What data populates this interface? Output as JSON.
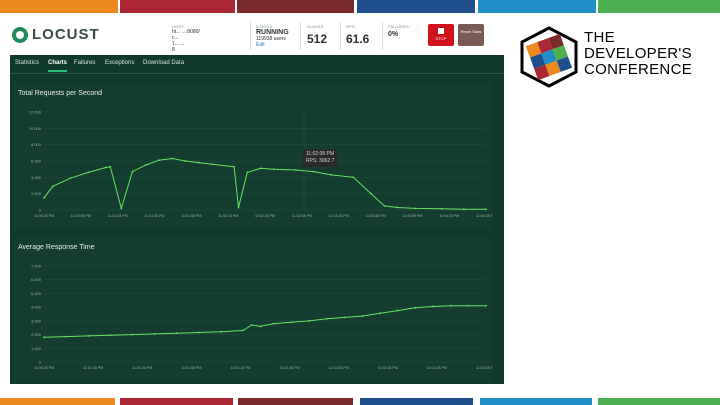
{
  "app": {
    "logo_text": "LOCUST",
    "host": {
      "label": "HOST",
      "line1": "ht... ...:8080/",
      "line2": "c... ",
      "line3": "1...  ...",
      "line4": "8"
    },
    "status": {
      "label": "STATUS",
      "value": "RUNNING",
      "sub": "119938 users",
      "link": "Edit"
    },
    "users": {
      "label": "SLAVES",
      "value": "512"
    },
    "rps": {
      "label": "RPS",
      "value": "61.6"
    },
    "failures": {
      "label": "FAILURES",
      "value": "0%"
    },
    "stop_label": "STOP",
    "reset_label": "Reset Stats",
    "tabs": [
      "Statistics",
      "Charts",
      "Failures",
      "Exceptions",
      "Download Data"
    ],
    "active_tab": "Charts"
  },
  "charts": {
    "rps_title": "Total Requests per Second",
    "rt_title": "Average Response Time",
    "tooltip": {
      "time": "11:02:08 PM",
      "value": "RPS: 3062.7"
    }
  },
  "brand": {
    "line1": "THE",
    "line2": "DEVELOPER'S",
    "line3": "CONFERENCE"
  },
  "colors": {
    "bg": "#0f3a2b",
    "line": "#63e55d",
    "stop": "#d0121c"
  },
  "chart_data": [
    {
      "type": "line",
      "title": "Total Requests per Second",
      "x": [
        "11:00:38 PM",
        "11:00:58 PM",
        "11:01:18 PM",
        "11:01:38 PM",
        "11:01:58 PM",
        "11:02:18 PM",
        "11:02:38 PM",
        "11:02:58 PM",
        "11:03:18 PM",
        "11:03:38 PM",
        "11:03:58 PM",
        "11:04:18 PM",
        "11:04:38 PM"
      ],
      "y_ticks": [
        "12,000",
        "10,000",
        "8,000",
        "6,000",
        "4,000",
        "2,000",
        "0"
      ],
      "ylim": [
        0,
        12000
      ],
      "series": [
        {
          "points": [
            [
              0,
              1500
            ],
            [
              0.02,
              2900
            ],
            [
              0.06,
              3900
            ],
            [
              0.1,
              4600
            ],
            [
              0.14,
              5200
            ],
            [
              0.15,
              5300
            ],
            [
              0.175,
              200
            ],
            [
              0.2,
              4700
            ],
            [
              0.23,
              5500
            ],
            [
              0.26,
              6100
            ],
            [
              0.29,
              6300
            ],
            [
              0.32,
              6000
            ],
            [
              0.35,
              5800
            ],
            [
              0.38,
              5600
            ],
            [
              0.43,
              5300
            ],
            [
              0.44,
              300
            ],
            [
              0.46,
              4600
            ],
            [
              0.49,
              5100
            ],
            [
              0.52,
              5000
            ],
            [
              0.57,
              4900
            ],
            [
              0.61,
              4700
            ],
            [
              0.65,
              4300
            ],
            [
              0.7,
              4000
            ],
            [
              0.74,
              2000
            ],
            [
              0.77,
              500
            ],
            [
              0.8,
              300
            ],
            [
              0.84,
              200
            ],
            [
              0.9,
              150
            ],
            [
              0.95,
              100
            ],
            [
              1.0,
              80
            ]
          ]
        }
      ]
    },
    {
      "type": "line",
      "title": "Average Response Time",
      "x": [
        "11:00:38 PM",
        "11:01:08 PM",
        "11:01:28 PM",
        "11:01:58 PM",
        "11:02:18 PM",
        "11:02:38 PM",
        "11:02:58 PM",
        "11:03:18 PM",
        "11:03:38 PM",
        "11:03:58 PM"
      ],
      "y_ticks": [
        "7,000",
        "6,000",
        "5,000",
        "4,000",
        "3,000",
        "2,000",
        "1,000",
        "0"
      ],
      "ylim": [
        0,
        7000
      ],
      "series": [
        {
          "points": [
            [
              0,
              1800
            ],
            [
              0.05,
              1850
            ],
            [
              0.1,
              1900
            ],
            [
              0.15,
              1950
            ],
            [
              0.2,
              2000
            ],
            [
              0.25,
              2050
            ],
            [
              0.3,
              2100
            ],
            [
              0.35,
              2150
            ],
            [
              0.4,
              2200
            ],
            [
              0.45,
              2300
            ],
            [
              0.47,
              2700
            ],
            [
              0.49,
              2600
            ],
            [
              0.52,
              2800
            ],
            [
              0.56,
              2900
            ],
            [
              0.6,
              3000
            ],
            [
              0.64,
              3150
            ],
            [
              0.68,
              3250
            ],
            [
              0.72,
              3350
            ],
            [
              0.76,
              3550
            ],
            [
              0.8,
              3750
            ],
            [
              0.84,
              3950
            ],
            [
              0.88,
              4050
            ],
            [
              0.92,
              4100
            ],
            [
              0.96,
              4100
            ],
            [
              1.0,
              4100
            ]
          ]
        }
      ]
    }
  ]
}
